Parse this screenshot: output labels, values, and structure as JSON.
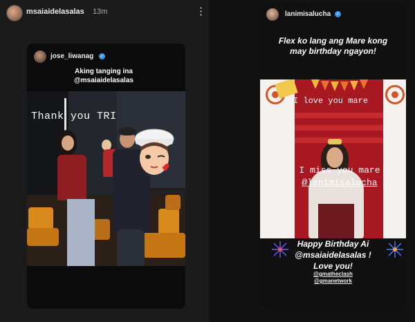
{
  "left_story": {
    "username": "msaiaidelasalas",
    "time": "13m",
    "more_icon": "more-vertical-icon",
    "repost": {
      "username": "jose_liwanag",
      "caption_line1": "Aking tanging ina",
      "caption_line2": "@msaiaidelasalas",
      "photo_text": "Thank you TRI"
    }
  },
  "right_story": {
    "username": "lanimisalucha",
    "flex_line1": "Flex ko lang ang Mare kong",
    "flex_line2": "may birthday ngayon!",
    "photo_love": "I love you mare",
    "photo_miss_line1": "I miss you mare",
    "photo_miss_line2": "@lanimisalucha",
    "happy_line1": "Happy Birthday Ai",
    "happy_line2": "@msaiaidelasalas !",
    "happy_line3": "Love you!",
    "tag1": "@gmatheclash",
    "tag2": "@gmanetwork"
  },
  "colors": {
    "background": "#121212",
    "verified": "#3897f0",
    "stage_red": "#a81820",
    "seat_orange": "#d98a1c"
  }
}
